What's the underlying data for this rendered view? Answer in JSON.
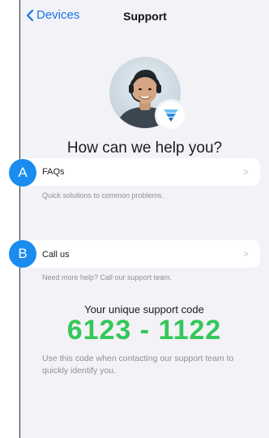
{
  "nav": {
    "back_label": "Devices",
    "title": "Support"
  },
  "hero": {
    "avatar_icon": "support-agent-photo",
    "badge_icon": "brand-logo-icon",
    "headline": "How can we help you?"
  },
  "options": [
    {
      "marker": "A",
      "label": "FAQs",
      "subtitle": "Quick solutions to common problems."
    },
    {
      "marker": "B",
      "label": "Call us",
      "subtitle": "Need more help? Call our support team."
    }
  ],
  "support_code": {
    "caption": "Your unique support code",
    "code": "6123 - 1122",
    "note": "Use this code when contacting our support team to quickly identify you."
  },
  "colors": {
    "accent": "#1a73e8",
    "marker": "#1a8cf0",
    "code": "#34c759",
    "background": "#f2f2f7"
  }
}
